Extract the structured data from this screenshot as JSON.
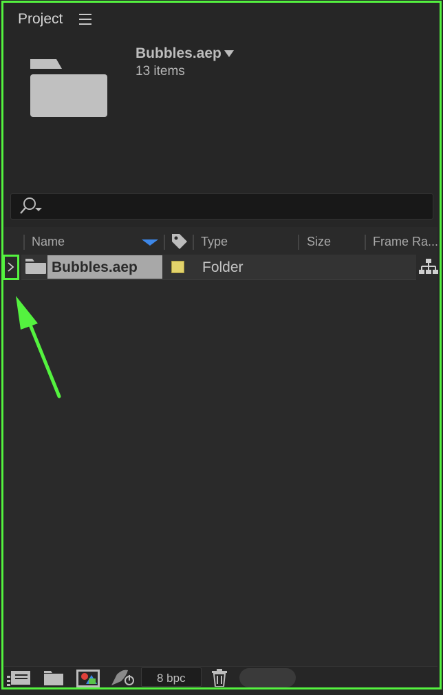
{
  "panel": {
    "title": "Project"
  },
  "project": {
    "name": "Bubbles.aep",
    "item_count": "13 items"
  },
  "search": {
    "placeholder": "",
    "value": ""
  },
  "columns": [
    "Name",
    "Type",
    "Size",
    "Frame Ra..."
  ],
  "rows": [
    {
      "name": "Bubbles.aep",
      "label_color": "#e3d36b",
      "type": "Folder",
      "icon": "folder-icon",
      "expanded": false
    }
  ],
  "footer": {
    "bit_depth": "8 bpc"
  },
  "annotation": {
    "color": "#54f23f"
  },
  "colors": {
    "accent_sort": "#3d87e8"
  }
}
